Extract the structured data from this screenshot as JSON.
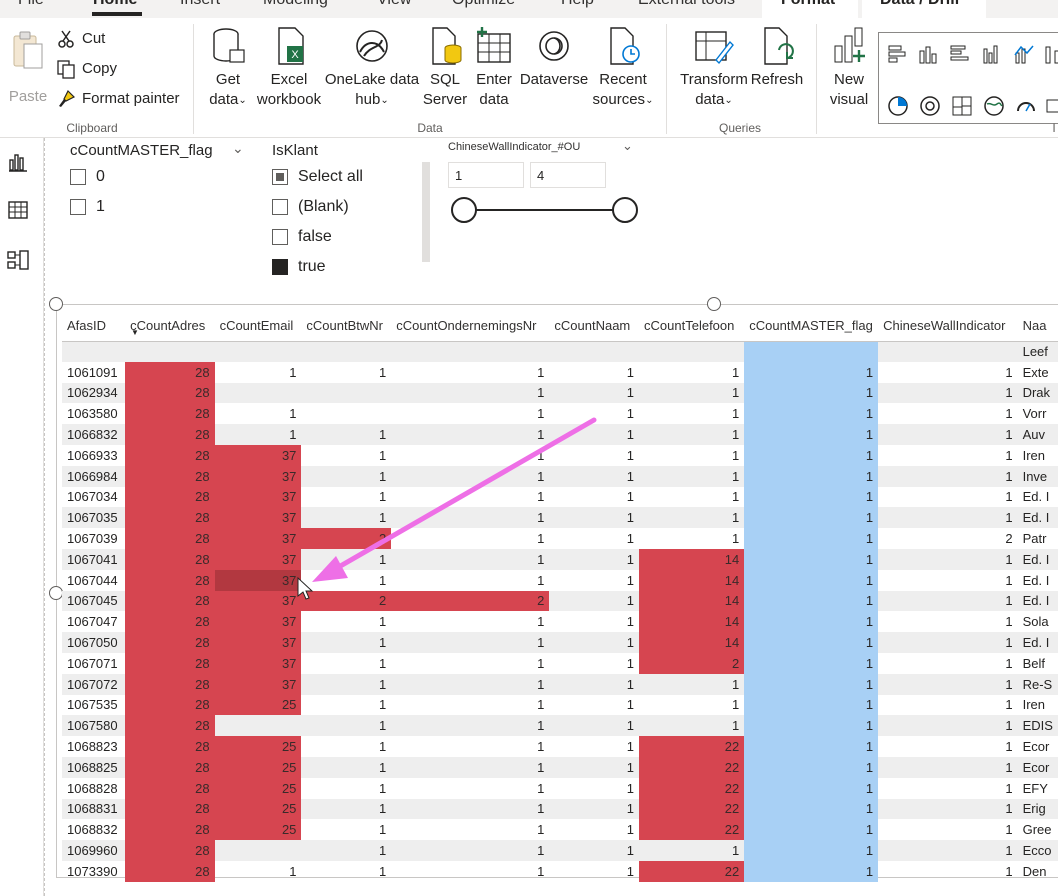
{
  "tabs": [
    "File",
    "Home",
    "Insert",
    "Modeling",
    "View",
    "Optimize",
    "Help",
    "External tools",
    "Format",
    "Data / Drill"
  ],
  "clipboard": {
    "paste": "Paste",
    "cut": "Cut",
    "copy": "Copy",
    "format_painter": "Format painter",
    "group_label": "Clipboard"
  },
  "data_group": {
    "get_data": [
      "Get",
      "data"
    ],
    "excel": [
      "Excel",
      "workbook"
    ],
    "onelake": [
      "OneLake data",
      "hub"
    ],
    "sql": [
      "SQL",
      "Server"
    ],
    "enter": [
      "Enter",
      "data"
    ],
    "dataverse": [
      "Dataverse",
      ""
    ],
    "recent": [
      "Recent",
      "sources"
    ],
    "group_label": "Data"
  },
  "queries_group": {
    "transform": [
      "Transform",
      "data"
    ],
    "refresh": [
      "Refresh",
      ""
    ],
    "group_label": "Queries"
  },
  "new_visual": [
    "New",
    "visual"
  ],
  "insert_label_partial": "I",
  "slicer_master": {
    "title": "cCountMASTER_flag",
    "items": [
      "0",
      "1"
    ]
  },
  "slicer_isklant": {
    "title": "IsKlant",
    "items": [
      "Select all",
      "(Blank)",
      "false",
      "true"
    ]
  },
  "slicer_chinese": {
    "title": "ChineseWallIndicator_#OU",
    "min": "1",
    "max": "4"
  },
  "table": {
    "columns": [
      "AfasID",
      "cCountAdres",
      "cCountEmail",
      "cCountBtwNr",
      "cCountOndernemingsNr",
      "cCountNaam",
      "cCountTelefoon",
      "cCountMASTER_flag",
      "ChineseWallIndicator",
      "Naa"
    ],
    "rows": [
      [
        "",
        "",
        "",
        "",
        "",
        "",
        "",
        "",
        "",
        "Leef"
      ],
      [
        "1061091",
        "28",
        "1",
        "1",
        "1",
        "1",
        "1",
        "1",
        "1",
        "Exte"
      ],
      [
        "1062934",
        "28",
        "",
        "",
        "1",
        "1",
        "1",
        "1",
        "1",
        "Drak"
      ],
      [
        "1063580",
        "28",
        "1",
        "",
        "1",
        "1",
        "1",
        "1",
        "1",
        "Vorr"
      ],
      [
        "1066832",
        "28",
        "1",
        "1",
        "1",
        "1",
        "1",
        "1",
        "1",
        "Auv"
      ],
      [
        "1066933",
        "28",
        "37",
        "1",
        "1",
        "1",
        "1",
        "1",
        "1",
        "Iren"
      ],
      [
        "1066984",
        "28",
        "37",
        "1",
        "1",
        "1",
        "1",
        "1",
        "1",
        "Inve"
      ],
      [
        "1067034",
        "28",
        "37",
        "1",
        "1",
        "1",
        "1",
        "1",
        "1",
        "Ed. I"
      ],
      [
        "1067035",
        "28",
        "37",
        "1",
        "1",
        "1",
        "1",
        "1",
        "1",
        "Ed. I"
      ],
      [
        "1067039",
        "28",
        "37",
        "2",
        "1",
        "1",
        "1",
        "1",
        "2",
        "Patr"
      ],
      [
        "1067041",
        "28",
        "37",
        "1",
        "1",
        "1",
        "14",
        "1",
        "1",
        "Ed. I"
      ],
      [
        "1067044",
        "28",
        "37",
        "1",
        "1",
        "1",
        "14",
        "1",
        "1",
        "Ed. I"
      ],
      [
        "1067045",
        "28",
        "37",
        "2",
        "2",
        "1",
        "14",
        "1",
        "1",
        "Ed. I"
      ],
      [
        "1067047",
        "28",
        "37",
        "1",
        "1",
        "1",
        "14",
        "1",
        "1",
        "Sola"
      ],
      [
        "1067050",
        "28",
        "37",
        "1",
        "1",
        "1",
        "14",
        "1",
        "1",
        "Ed. I"
      ],
      [
        "1067071",
        "28",
        "37",
        "1",
        "1",
        "1",
        "2",
        "1",
        "1",
        "Belf"
      ],
      [
        "1067072",
        "28",
        "37",
        "1",
        "1",
        "1",
        "1",
        "1",
        "1",
        "Re-S"
      ],
      [
        "1067535",
        "28",
        "25",
        "1",
        "1",
        "1",
        "1",
        "1",
        "1",
        "Iren"
      ],
      [
        "1067580",
        "28",
        "",
        "1",
        "1",
        "1",
        "1",
        "1",
        "1",
        "EDIS"
      ],
      [
        "1068823",
        "28",
        "25",
        "1",
        "1",
        "1",
        "22",
        "1",
        "1",
        "Ecor"
      ],
      [
        "1068825",
        "28",
        "25",
        "1",
        "1",
        "1",
        "22",
        "1",
        "1",
        "Ecor"
      ],
      [
        "1068828",
        "28",
        "25",
        "1",
        "1",
        "1",
        "22",
        "1",
        "1",
        "EFY"
      ],
      [
        "1068831",
        "28",
        "25",
        "1",
        "1",
        "1",
        "22",
        "1",
        "1",
        "Erig"
      ],
      [
        "1068832",
        "28",
        "25",
        "1",
        "1",
        "1",
        "22",
        "1",
        "1",
        "Gree"
      ],
      [
        "1069960",
        "28",
        "",
        "1",
        "1",
        "1",
        "1",
        "1",
        "1",
        "Ecco"
      ],
      [
        "1073390",
        "28",
        "1",
        "1",
        "1",
        "1",
        "22",
        "1",
        "1",
        "Den"
      ]
    ]
  },
  "colors": {
    "highlight_red": "#d64550",
    "highlight_red_hover": "#b23840",
    "highlight_blue": "#a8d0f5",
    "annotation_arrow": "#ee6fe6"
  }
}
